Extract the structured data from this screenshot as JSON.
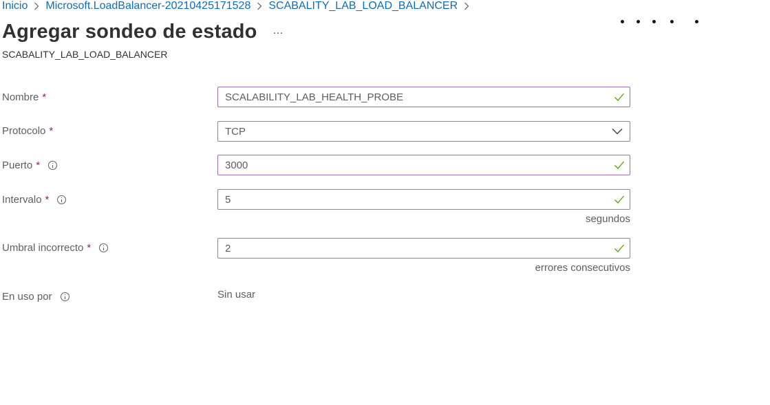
{
  "breadcrumb": {
    "items": [
      "Inicio",
      "Microsoft.LoadBalancer-20210425171528",
      "SCABALITY_LAB_LOAD_BALANCER"
    ]
  },
  "page": {
    "title": "Agregar sondeo de estado",
    "more_label": "···",
    "subtitle": "SCABALITY_LAB_LOAD_BALANCER"
  },
  "form": {
    "required_mark": "*",
    "nombre": {
      "label": "Nombre",
      "value": "SCALABILITY_LAB_HEALTH_PROBE"
    },
    "protocolo": {
      "label": "Protocolo",
      "value": "TCP"
    },
    "puerto": {
      "label": "Puerto",
      "value": "3000"
    },
    "intervalo": {
      "label": "Intervalo",
      "value": "5",
      "unit": "segundos"
    },
    "umbral": {
      "label": "Umbral incorrecto",
      "value": "2",
      "unit": "errores consecutivos"
    },
    "en_uso": {
      "label": "En uso por",
      "value": "Sin usar"
    }
  },
  "colors": {
    "link": "#0f6cbd",
    "valid_border": "#9b6bb5",
    "check": "#57a300",
    "required": "#a4262c"
  }
}
